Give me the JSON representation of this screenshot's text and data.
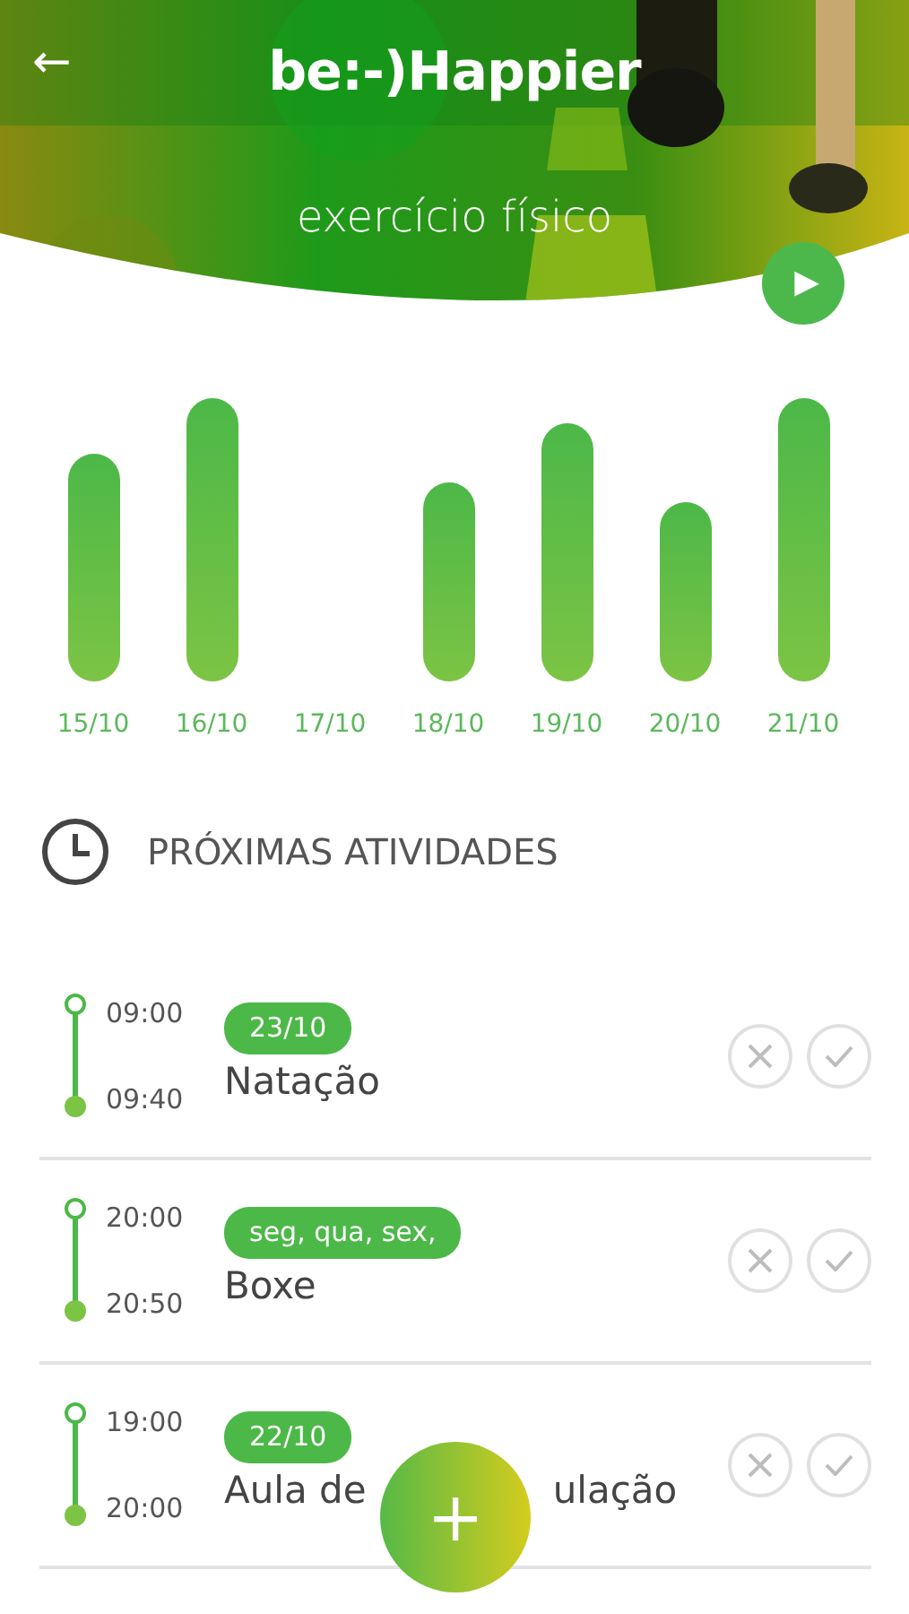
{
  "header": {
    "back": "←",
    "logo": "be:-)Happier",
    "title": "exercício físico",
    "play": "▶"
  },
  "days": [
    {
      "label": "15/10"
    },
    {
      "label": "16/10"
    },
    {
      "label": "17/10"
    },
    {
      "label": "18/10"
    },
    {
      "label": "19/10"
    },
    {
      "label": "20/10"
    },
    {
      "label": "21/10"
    }
  ],
  "section": {
    "title": "PRÓXIMAS ATIVIDADES"
  },
  "activities": [
    {
      "start": "09:00",
      "end": "09:40",
      "tag": "23/10",
      "title": [
        "Natação"
      ]
    },
    {
      "start": "20:00",
      "end": "20:50",
      "tag": "seg, qua, sex,",
      "title": [
        "Boxe"
      ]
    },
    {
      "start": "19:00",
      "end": "20:00",
      "tag": "22/10",
      "title": [
        "Aula de",
        "ulação"
      ]
    }
  ],
  "fab": "+"
}
